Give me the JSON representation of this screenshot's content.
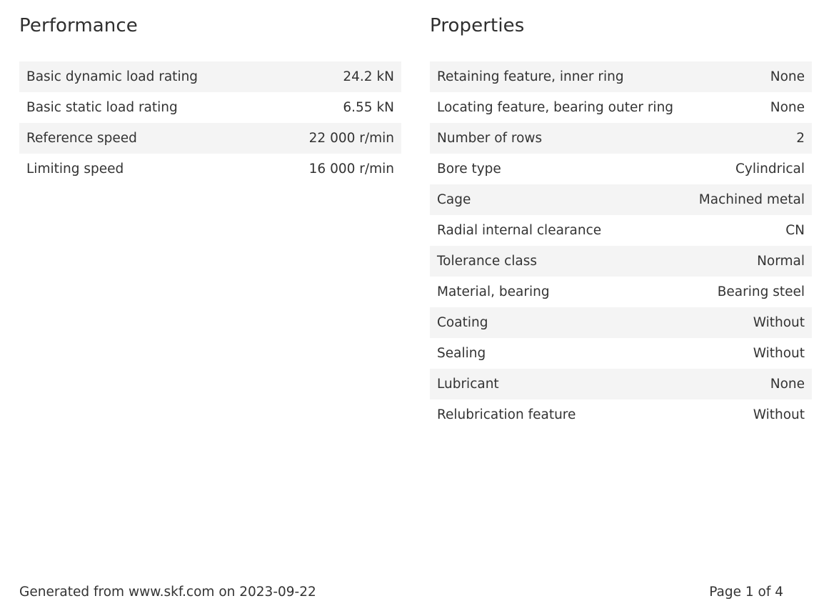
{
  "performance": {
    "title": "Performance",
    "rows": [
      {
        "label": "Basic dynamic load rating",
        "value": "24.2 kN"
      },
      {
        "label": "Basic static load rating",
        "value": "6.55 kN"
      },
      {
        "label": "Reference speed",
        "value": "22 000 r/min"
      },
      {
        "label": "Limiting speed",
        "value": "16 000 r/min"
      }
    ]
  },
  "properties": {
    "title": "Properties",
    "rows": [
      {
        "label": "Retaining feature, inner ring",
        "value": "None"
      },
      {
        "label": "Locating feature, bearing outer ring",
        "value": "None"
      },
      {
        "label": "Number of rows",
        "value": "2"
      },
      {
        "label": "Bore type",
        "value": "Cylindrical"
      },
      {
        "label": "Cage",
        "value": "Machined metal"
      },
      {
        "label": "Radial internal clearance",
        "value": "CN"
      },
      {
        "label": "Tolerance class",
        "value": "Normal"
      },
      {
        "label": "Material, bearing",
        "value": "Bearing steel"
      },
      {
        "label": "Coating",
        "value": "Without"
      },
      {
        "label": "Sealing",
        "value": "Without"
      },
      {
        "label": "Lubricant",
        "value": "None"
      },
      {
        "label": "Relubrication feature",
        "value": "Without"
      }
    ]
  },
  "footer": {
    "generated": "Generated from www.skf.com on 2023-09-22",
    "page": "Page 1 of 4"
  }
}
